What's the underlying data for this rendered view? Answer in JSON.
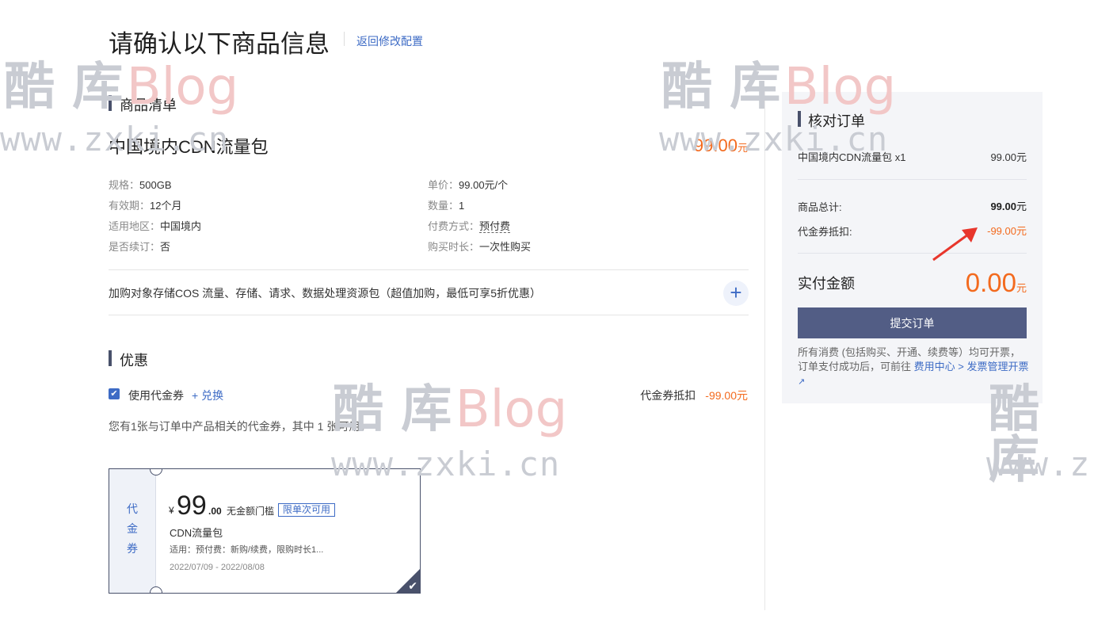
{
  "header": {
    "title": "请确认以下商品信息",
    "back_link": "返回修改配置"
  },
  "product_section": {
    "title": "商品清单",
    "product_name": "中国境内CDN流量包",
    "price": "99.00",
    "price_unit": "元",
    "specs_left": [
      {
        "key": "规格：",
        "value": "500GB"
      },
      {
        "key": "有效期：",
        "value": "12个月"
      },
      {
        "key": "适用地区：",
        "value": "中国境内"
      },
      {
        "key": "是否续订：",
        "value": "否"
      }
    ],
    "specs_right": [
      {
        "key": "单价：",
        "value": "99.00元/个"
      },
      {
        "key": "数量：",
        "value": "1"
      },
      {
        "key": "付费方式：",
        "value": "预付费"
      },
      {
        "key": "购买时长：",
        "value": "一次性购买"
      }
    ],
    "addon_text": "加购对象存储COS 流量、存储、请求、数据处理资源包（超值加购，最低可享5折优惠）",
    "addon_icon": "+"
  },
  "discount_section": {
    "title": "优惠",
    "checkbox_mark": "✔",
    "use_voucher_label": "使用代金券",
    "exchange_link": "+ 兑换",
    "deduct_label": "代金券抵扣",
    "deduct_value": "-99.00元",
    "voucher_count_text": "您有1张与订单中产品相关的代金券，其中 1 张可用。"
  },
  "voucher_card": {
    "side_chars": [
      "代",
      "金",
      "券"
    ],
    "currency": "¥",
    "amount": "99",
    "decimal": ".00",
    "threshold": "无金额门槛",
    "tag": "限单次可用",
    "name": "CDN流量包",
    "description": "适用：预付费：新购/续费，限购时长1...",
    "date_range": "2022/07/09 - 2022/08/08",
    "check_mark": "✔"
  },
  "order_panel": {
    "title": "核对订单",
    "item_name": "中国境内CDN流量包 x1",
    "item_price": "99.00元",
    "total_label": "商品总计:",
    "total_value": "99.00",
    "total_unit": "元",
    "voucher_label": "代金券抵扣:",
    "voucher_value": "-99.00元",
    "pay_label": "实付金额",
    "pay_value": "0.00",
    "pay_unit": "元",
    "submit_label": "提交订单",
    "note_prefix": "所有消费 (包括购买、开通、续费等）均可开票，订单支付成功后，可前往 ",
    "note_link": "费用中心 > 发票管理开票",
    "note_link_icon": "↗"
  },
  "watermark": {
    "cn": "酷 库",
    "blog": "Blog",
    "url": "www.zxki.cn",
    "url_partial": "www.z"
  },
  "colors": {
    "accent": "#3d6bc5",
    "price": "#f36a1e",
    "primary_button": "#525d85",
    "section_bar": "#49516b"
  }
}
